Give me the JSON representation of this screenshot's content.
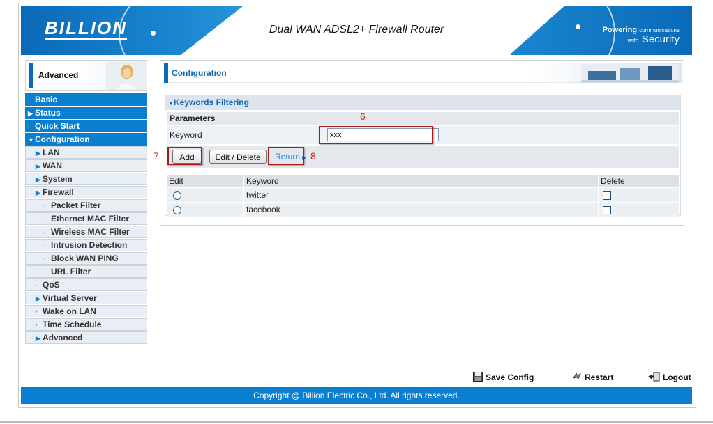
{
  "header": {
    "logo": "BILLION",
    "title": "Dual WAN ADSL2+ Firewall Router",
    "slogan_main": "Powering",
    "slogan_small": "communications",
    "slogan_with": "with",
    "slogan_security": "Security"
  },
  "sidebar": {
    "section_label": "Advanced",
    "items": [
      {
        "label": "Basic",
        "bullet": "·"
      },
      {
        "label": "Status",
        "bullet": "▶"
      },
      {
        "label": "Quick Start",
        "bullet": "·"
      },
      {
        "label": "Configuration",
        "bullet": "▼"
      },
      {
        "label": "LAN",
        "bullet": "▶"
      },
      {
        "label": "WAN",
        "bullet": "▶"
      },
      {
        "label": "System",
        "bullet": "▶"
      },
      {
        "label": "Firewall",
        "bullet": "▶"
      },
      {
        "label": "Packet Filter",
        "bullet": "·"
      },
      {
        "label": "Ethernet MAC Filter",
        "bullet": "·"
      },
      {
        "label": "Wireless MAC Filter",
        "bullet": "·"
      },
      {
        "label": "Intrusion Detection",
        "bullet": "·"
      },
      {
        "label": "Block WAN PING",
        "bullet": "·"
      },
      {
        "label": "URL Filter",
        "bullet": "·"
      },
      {
        "label": "QoS",
        "bullet": "·"
      },
      {
        "label": "Virtual Server",
        "bullet": "▶"
      },
      {
        "label": "Wake on LAN",
        "bullet": "·"
      },
      {
        "label": "Time Schedule",
        "bullet": "·"
      },
      {
        "label": "Advanced",
        "bullet": "▶"
      }
    ]
  },
  "main": {
    "section_title": "Configuration",
    "panel_title": "Keywords Filtering",
    "panel_toggle": "▼",
    "params_label": "Parameters",
    "keyword_label": "Keyword",
    "keyword_value": "xxx",
    "add_label": "Add",
    "edit_delete_label": "Edit / Delete",
    "return_label": "Return",
    "return_arrow": "▶",
    "annotations": {
      "a6": "6",
      "a7": "7",
      "a8": "8"
    },
    "table": {
      "headers": [
        "Edit",
        "Keyword",
        "Delete"
      ],
      "rows": [
        {
          "keyword": "twitter"
        },
        {
          "keyword": "facebook"
        }
      ]
    }
  },
  "footer": {
    "save_config": "Save Config",
    "restart": "Restart",
    "logout": "Logout",
    "copyright": "Copyright @ Billion Electric Co., Ltd. All rights reserved."
  },
  "colors": {
    "brand_blue": "#0a7fd0",
    "annotation_red": "#cc2222"
  }
}
